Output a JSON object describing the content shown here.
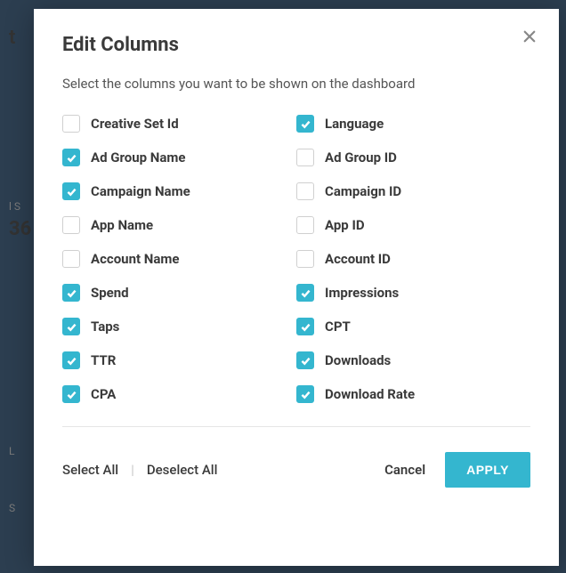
{
  "background": {
    "title_fragment": "t",
    "stat_label": "l S",
    "stat_value": "36",
    "label_l": "L",
    "label_s": "S"
  },
  "modal": {
    "title": "Edit Columns",
    "subtitle": "Select the columns you want to be shown on the dashboard",
    "columns": {
      "left": [
        {
          "label": "Creative Set Id",
          "checked": false
        },
        {
          "label": "Ad Group Name",
          "checked": true
        },
        {
          "label": "Campaign Name",
          "checked": true
        },
        {
          "label": "App Name",
          "checked": false
        },
        {
          "label": "Account Name",
          "checked": false
        },
        {
          "label": "Spend",
          "checked": true
        },
        {
          "label": "Taps",
          "checked": true
        },
        {
          "label": "TTR",
          "checked": true
        },
        {
          "label": "CPA",
          "checked": true
        }
      ],
      "right": [
        {
          "label": "Language",
          "checked": true
        },
        {
          "label": "Ad Group ID",
          "checked": false
        },
        {
          "label": "Campaign ID",
          "checked": false
        },
        {
          "label": "App ID",
          "checked": false
        },
        {
          "label": "Account ID",
          "checked": false
        },
        {
          "label": "Impressions",
          "checked": true
        },
        {
          "label": "CPT",
          "checked": true
        },
        {
          "label": "Downloads",
          "checked": true
        },
        {
          "label": "Download Rate",
          "checked": true
        }
      ]
    },
    "footer": {
      "select_all": "Select All",
      "deselect_all": "Deselect All",
      "cancel": "Cancel",
      "apply": "APPLY"
    }
  }
}
